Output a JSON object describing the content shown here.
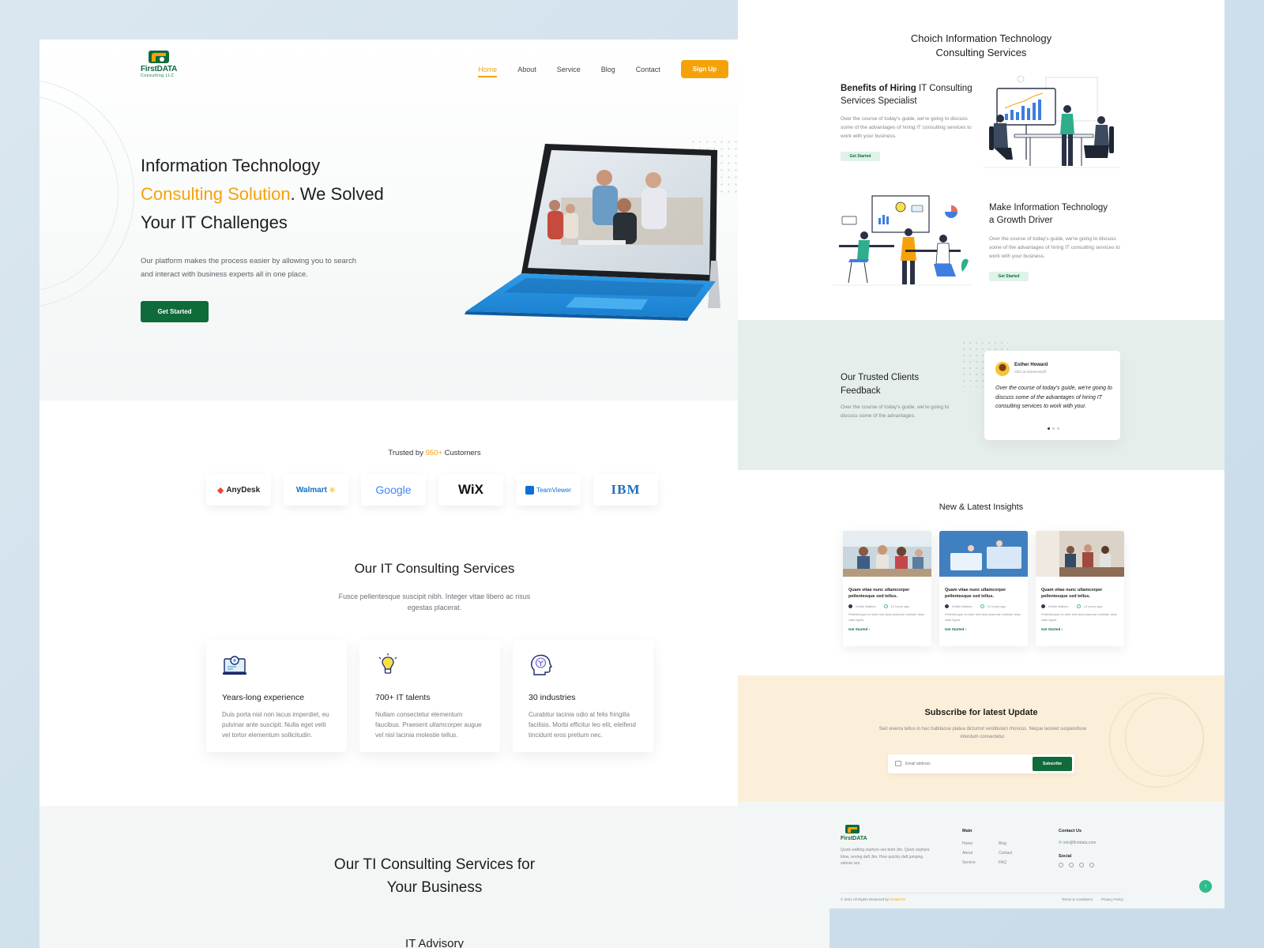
{
  "brand": {
    "name": "FirstDATA",
    "tagline": "Consulting LLC"
  },
  "nav": {
    "items": [
      "Home",
      "About",
      "Service",
      "Blog",
      "Contact"
    ],
    "active": "Home",
    "signup": "Sign Up"
  },
  "hero": {
    "line1": "Information Technology",
    "highlight": "Consulting Solution",
    "line2_rest": ". We Solved",
    "line3": "Your IT Challenges",
    "description": "Our platform makes the process easier by allowing you to search and interact with business experts all in one place.",
    "cta": "Get Started"
  },
  "trusted": {
    "prefix": "Trusted by ",
    "count": "950+",
    "suffix": " Customers"
  },
  "client_logos": [
    "AnyDesk",
    "Walmart",
    "Google",
    "WiX",
    "TeamViewer",
    "IBM"
  ],
  "services": {
    "title": "Our IT Consulting Services",
    "subtitle": "Fusce pellentesque suscipit nibh. Integer vitae libero ac risus egestas placerat.",
    "cards": [
      {
        "icon": "laptop-gear-icon",
        "title": "Years-long experience",
        "text": "Duis porta nisl non lacus imperdiet, eu pulvinar ante suscipit. Nulla eget velit vel tortor elementum sollicitudin."
      },
      {
        "icon": "lightbulb-icon",
        "title": "700+ IT talents",
        "text": "Nullam consectetur elementum faucibus. Praesent ullamcorper augue vel nisl lacinia molestie tellus."
      },
      {
        "icon": "head-circuit-icon",
        "title": "30 industries",
        "text": "Curabitur lacinia odio at felis fringilla facilisis. Morbi efficitur leo elit, eleifend tincidunt eros pretium nec."
      }
    ]
  },
  "business": {
    "title_line1": "Our TI Consulting Services for",
    "title_line2": "Your Business",
    "advisory": "IT Advisory"
  },
  "right": {
    "title_line1": "Choich Information Technology",
    "title_line2": "Consulting Services",
    "feature1": {
      "title_bold": "Benefits of Hiring",
      "title_rest": " IT Consulting",
      "title_line2": "Services Specialist",
      "text": "Over the course of today's guide, we're going to discuss some of the advantages of hiring IT consulting services to work with your business.",
      "cta": "Get Started"
    },
    "feature2": {
      "title_line1": "Make Information Technology",
      "title_line2": "a Growth Driver",
      "text": "Over the course of today's guide, we're going to discuss some of the advantages of hiring IT consulting services to work with your business.",
      "cta": "Get Started"
    },
    "feedback": {
      "title_line1": "Our Trusted Clients",
      "title_line2": "Feedback",
      "text": "Over the course of today's guide, we're going to discuss some of the advantages.",
      "name": "Esther Howard",
      "role": "CEO at ScienceSoft",
      "quote": "Over the course of today's guide, we're going to discuss some of the advantages of hiring IT consulting services to work with your."
    },
    "insights": {
      "title": "New & Latest Insights",
      "cards": [
        {
          "title": "Quam vitae nunc ullamcorper pellentesque sed tellus.",
          "author": "Kristin Watson",
          "time": "12 hours ago",
          "text": "Pellentesque eu ante sed diam placerat molestie vitae vitae ligula.",
          "cta": "Get Started"
        },
        {
          "title": "Quam vitae nunc ullamcorper pellentesque sed tellus.",
          "author": "Kristin Watson",
          "time": "12 hours ago",
          "text": "Pellentesque eu ante sed diam placerat molestie vitae vitae ligula.",
          "cta": "Get Started"
        },
        {
          "title": "Quam vitae nunc ullamcorper pellentesque sed tellus.",
          "author": "Kristin Watson",
          "time": "12 hours ago",
          "text": "Pellentesque eu ante sed diam placerat molestie vitae vitae ligula.",
          "cta": "Get Started"
        }
      ]
    },
    "subscribe": {
      "title": "Subscribe for latest Update",
      "text": "Sed viverra tellus in hac habitasse platea dictumst vestibulum rhoncus. Neque laoreet suspendisse interdum consectetur.",
      "placeholder": "Email address",
      "button": "Subscribe"
    },
    "footer": {
      "description": "Quick wafting zephyrs vex bold Jim. Quick zephyrs blow, vexing daft Jim. How quickly daft jumping zebras vex.",
      "main_heading": "Main",
      "main_links_col1": [
        "Home",
        "About",
        "Service"
      ],
      "main_links_col2": [
        "Blog",
        "Contact",
        "FAQ"
      ],
      "contact_heading": "Contact Us",
      "email": "info@firstdata.com",
      "social_heading": "Social",
      "copyright": "© 2021 All Rights Reserved by ",
      "copyright_brand": "FirstDATA",
      "terms": "Terms & Conditions",
      "privacy": "Privacy Policy"
    }
  },
  "colors": {
    "brand_green": "#0f6b3a",
    "accent_orange": "#f5a20a",
    "teal": "#2dbd8a"
  }
}
